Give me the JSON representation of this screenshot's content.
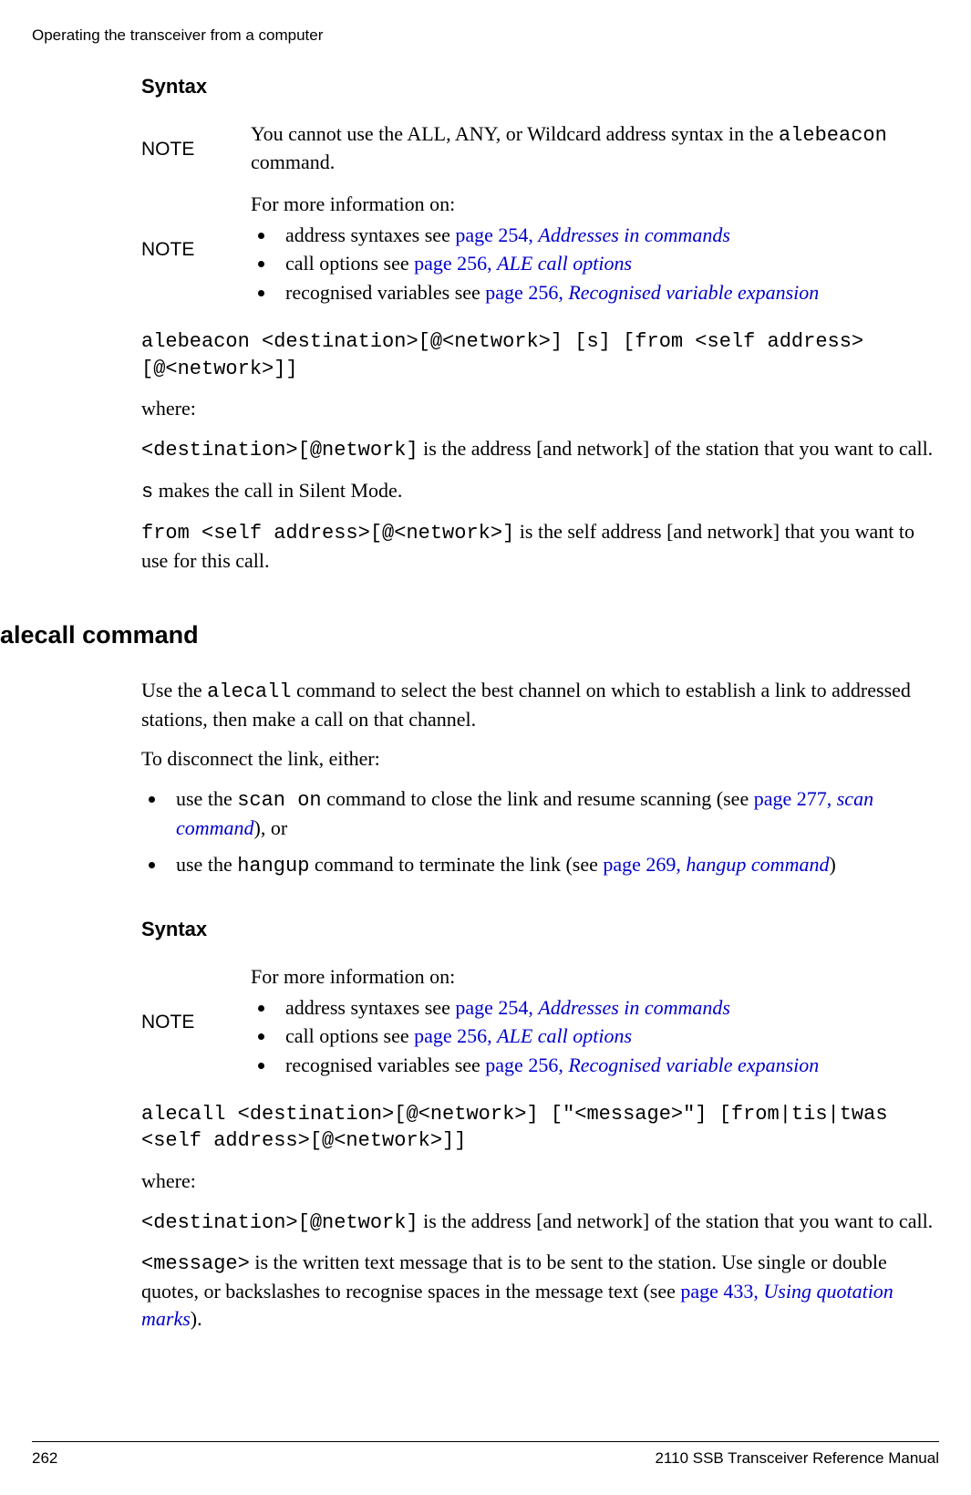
{
  "header": {
    "running": "Operating the transceiver from a computer"
  },
  "syntax1": {
    "heading": "Syntax",
    "note1_label": "NOTE",
    "note1_text_a": "You cannot use the ALL, ANY, or Wildcard address syntax in the ",
    "note1_code": "alebeacon",
    "note1_text_b": " command.",
    "note2_label": "NOTE",
    "note2_intro": "For more information on:",
    "note2_items": {
      "i1_a": "address syntaxes see ",
      "i1_link": "page 254, ",
      "i1_link_i": "Addresses in commands",
      "i2_a": "call options see ",
      "i2_link": "page 256, ",
      "i2_link_i": "ALE call options",
      "i3_a": "recognised variables see ",
      "i3_link": "page 256, ",
      "i3_link_i": "Recognised variable expansion"
    },
    "cmd": "alebeacon <destination>[@<network>] [s] [from <self address>[@<network>]]",
    "where": "where:",
    "p1_code": "<destination>[@network]",
    "p1_rest": " is the address [and network] of the station that you want to call.",
    "p2_code": "s",
    "p2_rest": " makes the call in Silent Mode.",
    "p3_code": "from <self address>[@<network>]",
    "p3_rest": " is the self address [and network] that you want to use for this call."
  },
  "alecall": {
    "heading": "alecall command",
    "intro_a": "Use the ",
    "intro_code": "alecall",
    "intro_b": " command to select the best channel on which to establish a link to addressed stations, then make a call on that channel.",
    "disc_intro": "To disconnect the link, either:",
    "li1_a": "use the ",
    "li1_code": "scan on",
    "li1_b": " command to close the link and resume scanning (see ",
    "li1_link": "page 277, ",
    "li1_link_i": "scan command",
    "li1_c": "), or",
    "li2_a": "use the ",
    "li2_code": "hangup",
    "li2_b": " command to terminate the link (see ",
    "li2_link": "page 269, ",
    "li2_link_i": "hangup command",
    "li2_c": ")"
  },
  "syntax2": {
    "heading": "Syntax",
    "note_label": "NOTE",
    "note_intro": "For more information on:",
    "items": {
      "i1_a": "address syntaxes see ",
      "i1_link": "page 254, ",
      "i1_link_i": "Addresses in commands",
      "i2_a": "call options see ",
      "i2_link": "page 256, ",
      "i2_link_i": "ALE call options",
      "i3_a": "recognised variables see ",
      "i3_link": "page 256, ",
      "i3_link_i": "Recognised variable expansion"
    },
    "cmd": "alecall <destination>[@<network>] [\"<message>\"] [from|tis|twas <self address>[@<network>]]",
    "where": "where:",
    "p1_code": "<destination>[@network]",
    "p1_rest": " is the address [and network] of the station that you want to call.",
    "p2_code": "<message>",
    "p2_rest_a": " is the written text message that is to be sent to the station. Use single or double quotes, or backslashes to recognise spaces in the message text (see ",
    "p2_link": "page 433, ",
    "p2_link_i": "Using quotation marks",
    "p2_rest_b": ")."
  },
  "footer": {
    "page_no": "262",
    "title": "2110 SSB Transceiver Reference Manual"
  }
}
